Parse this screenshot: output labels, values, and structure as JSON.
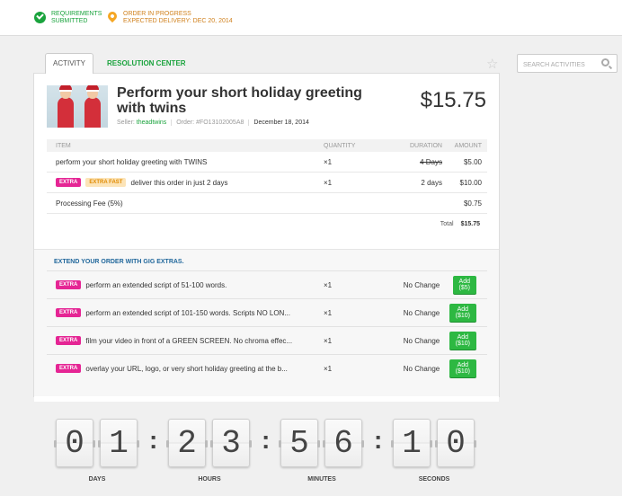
{
  "status": {
    "step1": "REQUIREMENTS SUBMITTED",
    "step1_line1": "REQUIREMENTS",
    "step1_line2": "SUBMITTED",
    "step2_line1": "ORDER IN PROGRESS",
    "step2_line2": "EXPECTED DELIVERY: DEC 20, 2014"
  },
  "tabs": {
    "activity": "ACTIVITY",
    "resolution": "RESOLUTION CENTER"
  },
  "search": {
    "placeholder": "SEARCH ACTIVITIES"
  },
  "order": {
    "title": "Perform your short holiday greeting with twins",
    "price": "$15.75",
    "seller_label": "Seller:",
    "seller": "theadtwins",
    "order_label": "Order:",
    "order_id": "#FO13102005A8",
    "date": "December 18, 2014"
  },
  "table": {
    "headers": {
      "item": "ITEM",
      "quantity": "QUANTITY",
      "duration": "DURATION",
      "amount": "AMOUNT"
    },
    "rows": [
      {
        "item": "perform your short holiday greeting with TWINS",
        "qty": "×1",
        "duration": "4 Days",
        "amount": "$5.00"
      },
      {
        "badge1": "EXTRA",
        "badge2": "EXTRA FAST",
        "item": "deliver this order in just 2 days",
        "qty": "×1",
        "duration": "2 days",
        "amount": "$10.00"
      },
      {
        "item": "Processing Fee (5%)",
        "amount": "$0.75"
      }
    ],
    "total_label": "Total",
    "total_value": "$15.75"
  },
  "extras": {
    "heading": "EXTEND YOUR ORDER WITH GIG EXTRAS.",
    "badge": "EXTRA",
    "items": [
      {
        "text": "perform an extended script of 51-100 words.",
        "qty": "×1",
        "change": "No Change",
        "button": "Add ($5)"
      },
      {
        "text": "perform an extended script of 101-150 words. Scripts NO LON...",
        "qty": "×1",
        "change": "No Change",
        "button": "Add ($10)"
      },
      {
        "text": "film your video in front of a GREEN SCREEN. No chroma effec...",
        "qty": "×1",
        "change": "No Change",
        "button": "Add ($10)"
      },
      {
        "text": "overlay your URL, logo, or very short holiday greeting at the b...",
        "qty": "×1",
        "change": "No Change",
        "button": "Add ($10)"
      }
    ]
  },
  "countdown": {
    "digits": [
      "0",
      "1",
      "2",
      "3",
      "5",
      "6",
      "1",
      "0"
    ],
    "colon": ":",
    "labels": [
      "DAYS",
      "HOURS",
      "MINUTES",
      "SECONDS"
    ]
  },
  "colors": {
    "green": "#1aa33d",
    "orange": "#d0801c",
    "pink": "#e52594",
    "blue": "#22689c"
  }
}
